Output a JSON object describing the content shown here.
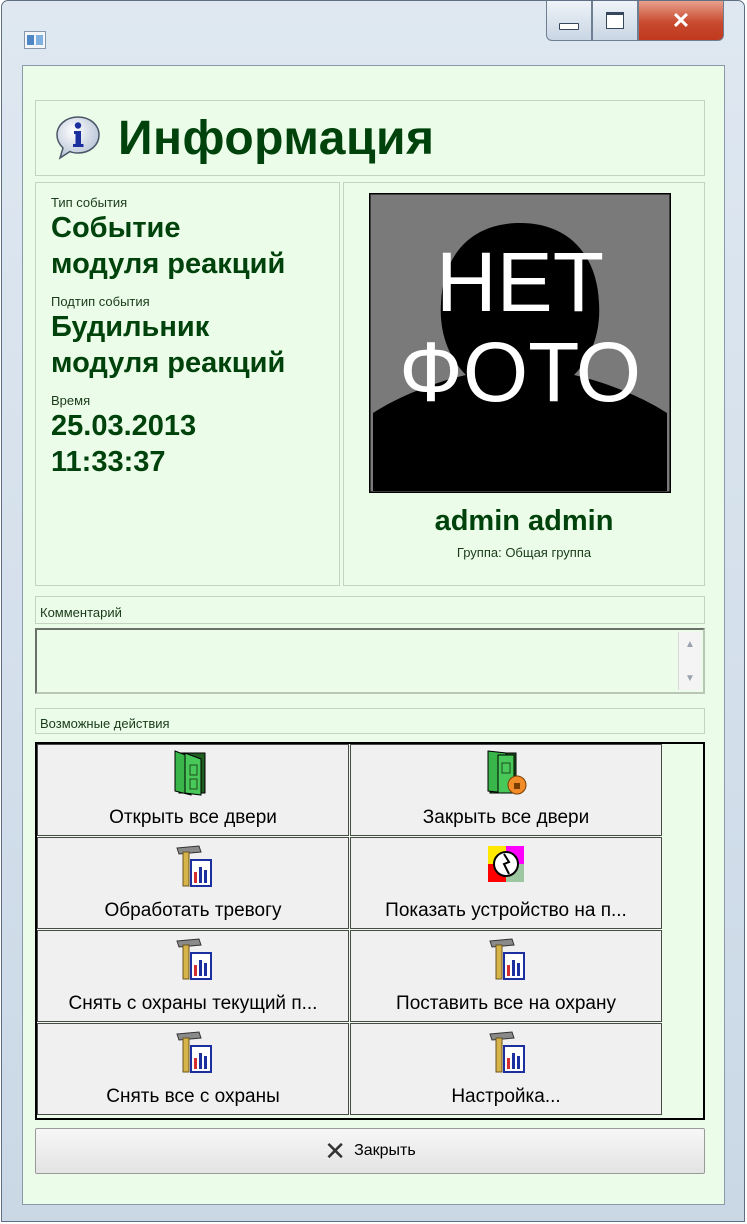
{
  "window": {
    "title": ""
  },
  "header": {
    "title": "Информация",
    "icon": "info-icon"
  },
  "details": {
    "type_label": "Тип события",
    "type_value_line1": "Событие",
    "type_value_line2": "модуля реакций",
    "subtype_label": "Подтип события",
    "subtype_value_line1": "Будильник",
    "subtype_value_line2": "модуля реакций",
    "time_label": "Время",
    "time_date": "25.03.2013",
    "time_clock": "11:33:37"
  },
  "user": {
    "photo_text_line1": "НЕТ",
    "photo_text_line2": "ФОТО",
    "name": "admin admin",
    "group": "Группа: Общая группа"
  },
  "comment": {
    "label": "Комментарий",
    "value": ""
  },
  "actions": {
    "label": "Возможные действия",
    "items": [
      {
        "label": "Открыть все двери",
        "icon": "open-doors-icon"
      },
      {
        "label": "Закрыть все двери",
        "icon": "close-doors-icon"
      },
      {
        "label": "Обработать тревогу",
        "icon": "hammer-chart-icon"
      },
      {
        "label": "Показать устройство на п...",
        "icon": "show-device-icon"
      },
      {
        "label": "Снять с охраны текущий п...",
        "icon": "hammer-chart-icon"
      },
      {
        "label": "Поставить все на охрану",
        "icon": "hammer-chart-icon"
      },
      {
        "label": "Снять все с охраны",
        "icon": "hammer-chart-icon"
      },
      {
        "label": "Настройка...",
        "icon": "hammer-chart-icon"
      }
    ]
  },
  "close_button": {
    "label": "Закрыть",
    "icon": "close-x-icon"
  }
}
